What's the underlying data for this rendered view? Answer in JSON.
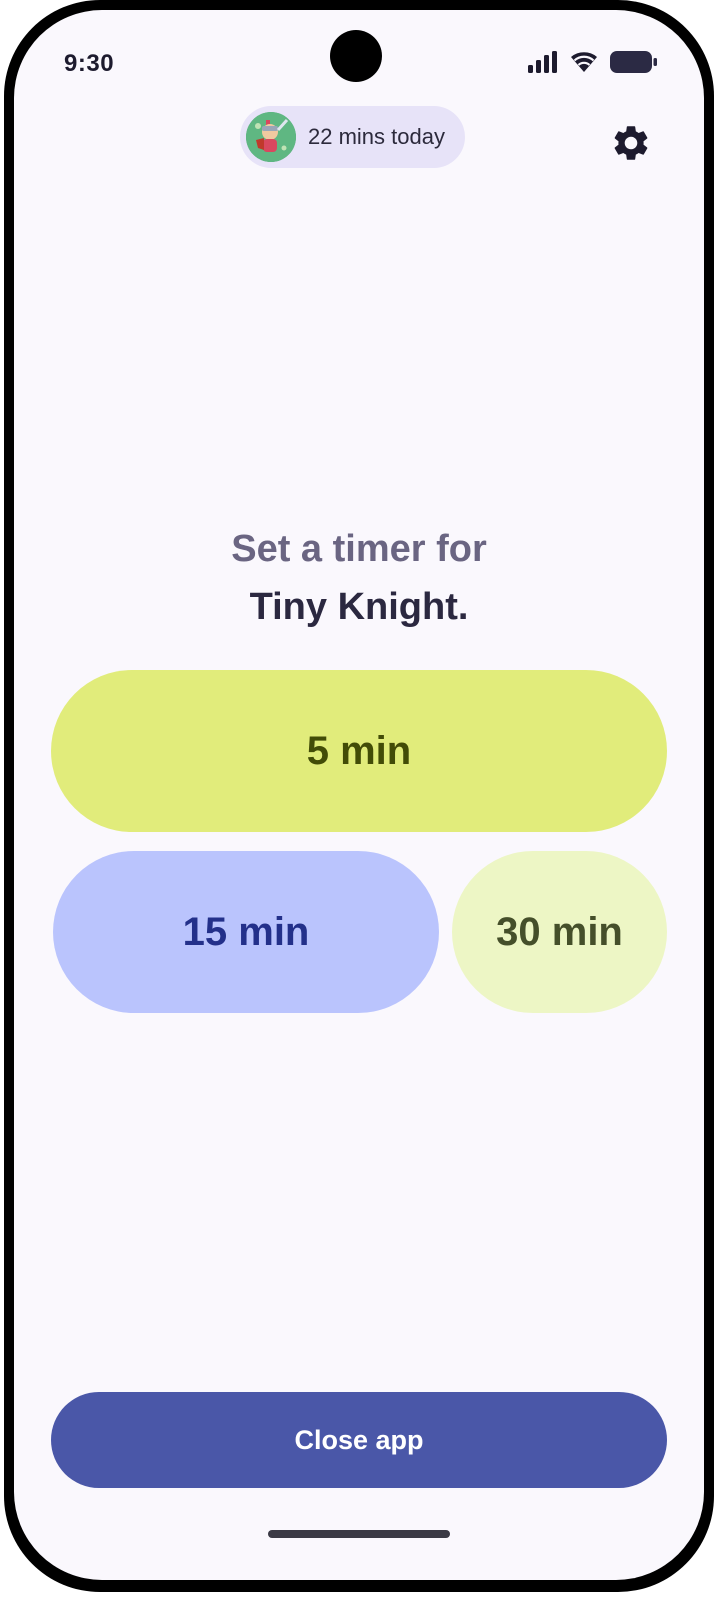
{
  "status_bar": {
    "time": "9:30",
    "icons": [
      "signal-icon",
      "wifi-icon",
      "battery-icon"
    ]
  },
  "header": {
    "avatar_icon": "knight-avatar-icon",
    "usage_text": "22 mins today",
    "settings_icon": "gear-icon"
  },
  "prompt": {
    "line1": "Set a timer for",
    "line2": "Tiny Knight."
  },
  "timer_options": [
    {
      "label": "5 min",
      "color": "#e1ec7b"
    },
    {
      "label": "15 min",
      "color": "#bac4fd"
    },
    {
      "label": "30 min",
      "color": "#edf6c5"
    }
  ],
  "footer": {
    "close_label": "Close app",
    "accent": "#4a57a8"
  }
}
